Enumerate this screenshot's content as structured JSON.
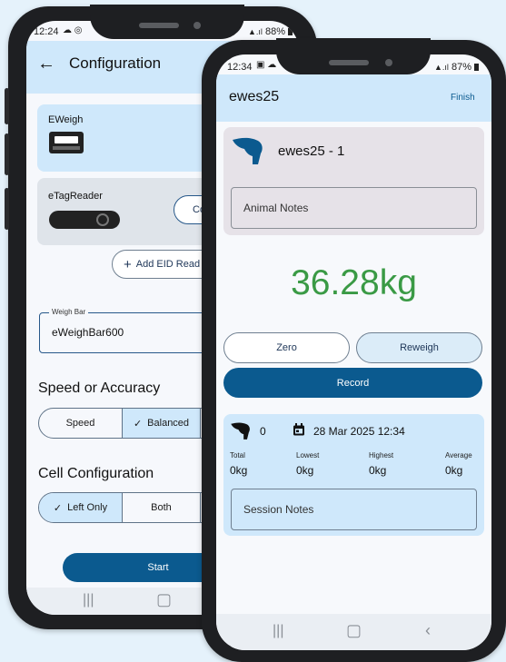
{
  "colors": {
    "accent": "#0b5a8f",
    "weight": "#3a9a45",
    "card_blue": "#cfe8fb"
  },
  "config_screen": {
    "status": {
      "time": "12:24",
      "battery": "88%"
    },
    "title": "Configuration",
    "devices": [
      {
        "name": "EWeigh"
      },
      {
        "name": "eTagReader",
        "action": "Co"
      }
    ],
    "add_eid_label": "Add EID Read",
    "weigh_bar": {
      "label": "Weigh Bar",
      "value": "eWeighBar600"
    },
    "speed_section": {
      "title": "Speed or Accuracy",
      "options": [
        "Speed",
        "Balanced"
      ],
      "selected": "Balanced"
    },
    "cell_section": {
      "title": "Cell Configuration",
      "options": [
        "Left Only",
        "Both"
      ],
      "selected": "Left Only"
    },
    "start_label": "Start"
  },
  "session_screen": {
    "status": {
      "time": "12:34",
      "battery": "87%"
    },
    "title": "ewes25",
    "finish_label": "Finish",
    "animal": {
      "name": "ewes25 - 1",
      "notes_placeholder": "Animal Notes"
    },
    "weight": "36.28kg",
    "zero_label": "Zero",
    "reweigh_label": "Reweigh",
    "record_label": "Record",
    "session": {
      "count": "0",
      "date": "28 Mar 2025 12:34",
      "stats": [
        {
          "label": "Total",
          "value": "0kg"
        },
        {
          "label": "Lowest",
          "value": "0kg"
        },
        {
          "label": "Highest",
          "value": "0kg"
        },
        {
          "label": "Average",
          "value": "0kg"
        }
      ],
      "notes_placeholder": "Session Notes"
    }
  }
}
